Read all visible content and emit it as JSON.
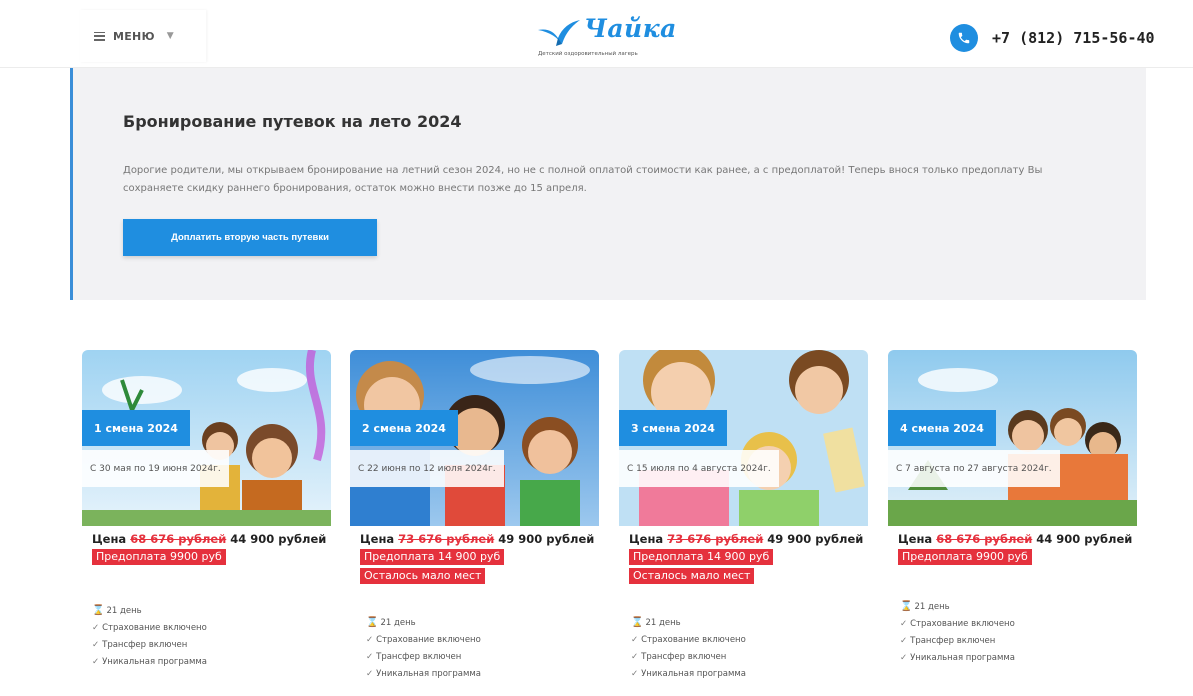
{
  "header": {
    "menu_label": "МЕНЮ",
    "logo_name": "Чайка",
    "logo_subtitle": "Детский оздоровительный лагерь",
    "phone": "+7 (812) 715-56-40",
    "accent_color": "#1f8ee0"
  },
  "banner": {
    "title": "Бронирование путевок на лето 2024",
    "text": "Дорогие родители, мы открываем бронирование на летний сезон 2024, но не с полной оплатой стоимости как ранее, а с предоплатой! Теперь внося только предоплату Вы сохраняете скидку раннего бронирования, остаток можно внести позже до 15 апреля.",
    "button_label": "Доплатить вторую часть путевки"
  },
  "cards": [
    {
      "shift": "1 смена 2024",
      "dates": "С 30 мая по 19 июня 2024г.",
      "price_label": "Цена",
      "old_price": "68 676 рублей",
      "new_price": "44 900 рублей",
      "badges": [
        "Предоплата 9900 руб"
      ],
      "features": [
        "21 день",
        "Страхование включено",
        "Трансфер включен",
        "Уникальная программа"
      ]
    },
    {
      "shift": "2 смена 2024",
      "dates": "С 22 июня по 12 июля 2024г.",
      "price_label": "Цена",
      "old_price": "73 676 рублей",
      "new_price": "49 900 рублей",
      "badges": [
        "Предоплата 14 900 руб",
        "Осталось мало мест"
      ],
      "features": [
        "21 день",
        "Страхование включено",
        "Трансфер включен",
        "Уникальная программа"
      ]
    },
    {
      "shift": "3 смена 2024",
      "dates": "С 15 июля по 4 августа 2024г.",
      "price_label": "Цена",
      "old_price": "73 676 рублей",
      "new_price": "49 900 рублей",
      "badges": [
        "Предоплата 14 900 руб",
        "Осталось мало мест"
      ],
      "features": [
        "21 день",
        "Страхование включено",
        "Трансфер включен",
        "Уникальная программа"
      ]
    },
    {
      "shift": "4 смена 2024",
      "dates": "С 7 августа по 27 августа 2024г.",
      "price_label": "Цена",
      "old_price": "68 676 рублей",
      "new_price": "44 900 рублей",
      "badges": [
        "Предоплата 9900 руб"
      ],
      "features": [
        "21 день",
        "Страхование включено",
        "Трансфер включен",
        "Уникальная программа"
      ]
    }
  ]
}
